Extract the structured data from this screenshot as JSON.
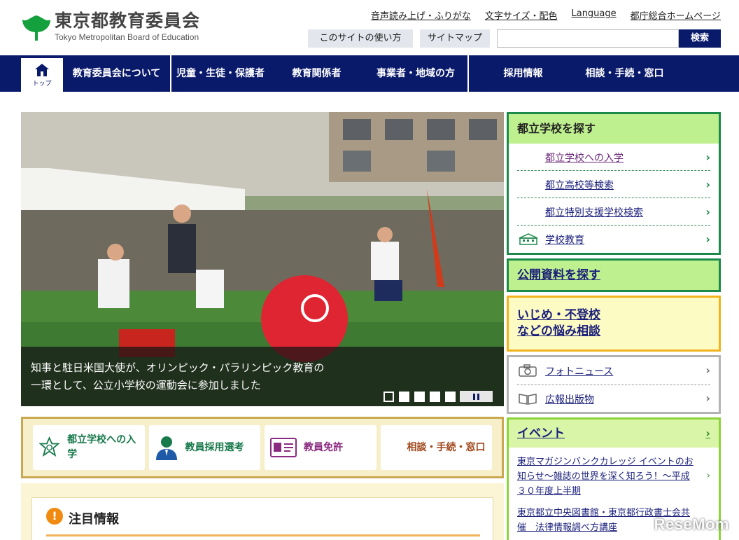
{
  "header": {
    "logo_ja": "東京都教育委員会",
    "logo_en": "Tokyo Metropolitan Board of Education",
    "util_links": [
      "音声読み上げ・ふりがな",
      "文字サイズ・配色",
      "Language",
      "都庁総合ホームページ"
    ],
    "sub_buttons": [
      "このサイトの使い方",
      "サイトマップ"
    ],
    "search_value": "",
    "search_button": "検索"
  },
  "nav": {
    "home_label": "トップ",
    "items": [
      "教育委員会について",
      "児童・生徒・保護者",
      "教育関係者",
      "事業者・地域の方",
      "採用情報",
      "相談・手続・窓口"
    ]
  },
  "hero": {
    "caption_line1": "知事と駐日米国大使が、オリンピック・パラリンピック教育の",
    "caption_line2": "一環として、公立小学校の運動会に参加しました",
    "slide_count": 5,
    "active_slide": 1
  },
  "quick_links": [
    "都立学校への入学",
    "教員採用選考",
    "教員免許",
    "相談・手続・窓口"
  ],
  "attention": {
    "title": "注目情報"
  },
  "school_search": {
    "title": "都立学校を探す",
    "items": [
      "都立学校への入学",
      "都立高校等検索",
      "都立特別支援学校検索",
      "学校教育"
    ]
  },
  "open_data": {
    "label": "公開資料を探す"
  },
  "consult": {
    "line1": "いじめ・不登校",
    "line2": "などの悩み相談"
  },
  "media": {
    "items": [
      "フォトニュース",
      "広報出版物"
    ]
  },
  "event": {
    "title": "イベント",
    "items": [
      "東京マガジンバンクカレッジ イベントのお知らせ〜雑誌の世界を深く知ろう！〜平成３０年度上半期",
      "東京都立中央図書館・東京都行政書士会共催　法律情報調べ方講座"
    ]
  },
  "watermark": "ReseMom",
  "colors": {
    "navy": "#0a1a6b",
    "green": "#1c8a4a",
    "yellow": "#f2b21e",
    "lime": "#bff08f"
  }
}
